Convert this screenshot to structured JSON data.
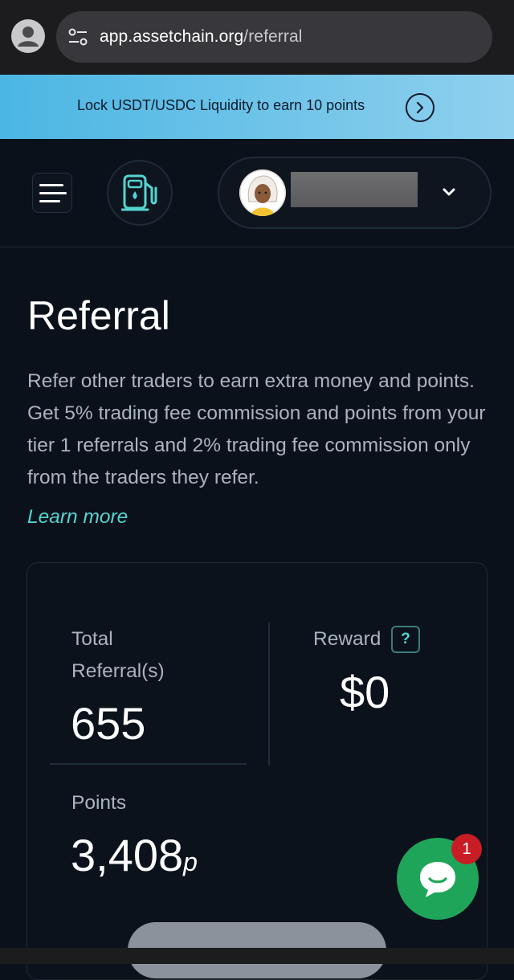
{
  "browser": {
    "url_host": "app.assetchain.org",
    "url_path": "/referral"
  },
  "banner": {
    "text": "Lock USDT/USDC Liquidity to earn 10 points"
  },
  "header": {
    "icons": [
      "menu-icon",
      "gas-pump-icon",
      "avatar",
      "chevron-down-icon"
    ]
  },
  "page": {
    "title": "Referral",
    "description": "Refer other traders to earn extra money and points. Get 5% trading fee commission and points from your tier 1 referrals and 2% trading fee commission only from the traders they refer.",
    "learn_more": "Learn more"
  },
  "stats": {
    "total_referrals_label_line1": "Total",
    "total_referrals_label_line2": "Referral(s)",
    "total_referrals_value": "655",
    "reward_label": "Reward",
    "reward_help": "?",
    "reward_value": "$0",
    "points_label": "Points",
    "points_value": "3,408",
    "points_suffix": "p"
  },
  "chat": {
    "badge_count": "1"
  },
  "colors": {
    "background": "#0b111a",
    "accent": "#55d3d0",
    "banner_start": "#4bb6e3",
    "banner_end": "#8fd0ee",
    "chat": "#1fa55a",
    "badge": "#c81d25"
  }
}
